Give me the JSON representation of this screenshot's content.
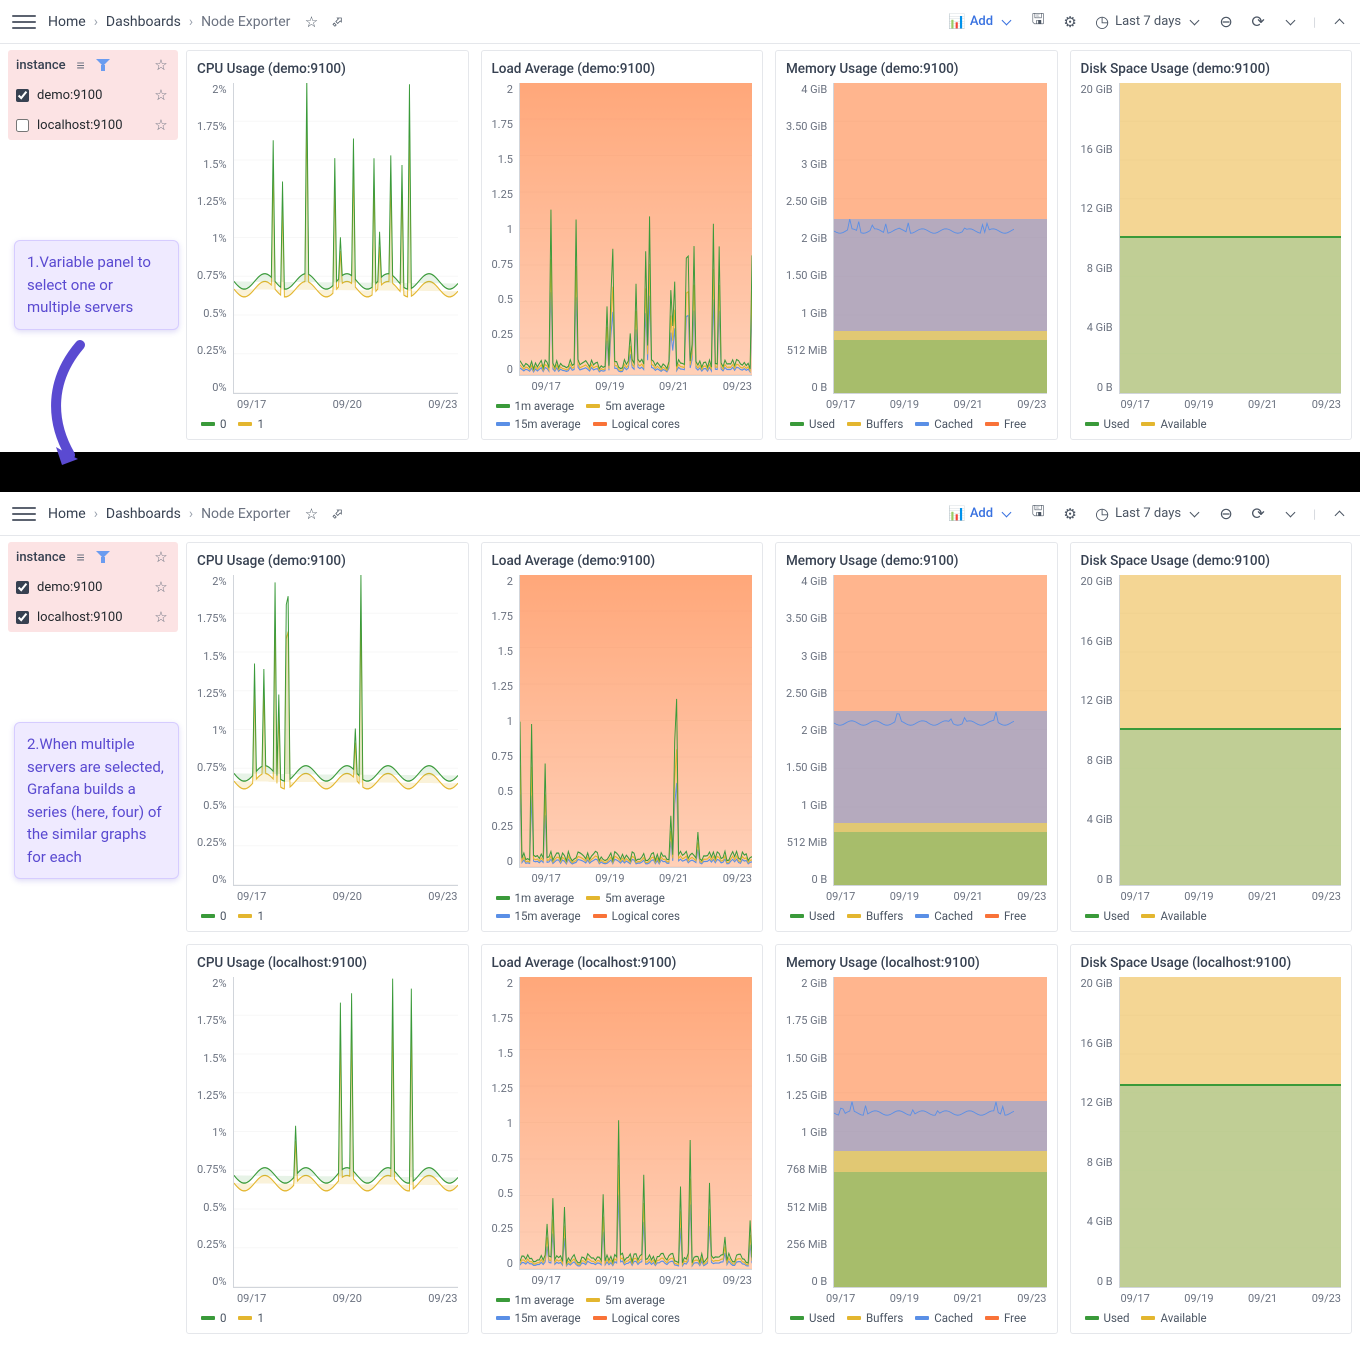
{
  "toolbar": {
    "breadcrumb": {
      "home": "Home",
      "dashboards": "Dashboards",
      "current": "Node Exporter"
    },
    "add": "Add",
    "timerange": "Last 7 days"
  },
  "annotations": {
    "a1": "1.Variable panel to select one or multiple servers",
    "a2": "2.When  multiple servers are selected, Grafana builds a series (here, four) of the similar graphs for each"
  },
  "sections": [
    {
      "varpanel": {
        "title": "instance",
        "items": [
          {
            "label": "demo:9100",
            "checked": true
          },
          {
            "label": "localhost:9100",
            "checked": false
          }
        ]
      },
      "panels_for": [
        "demo:9100"
      ]
    },
    {
      "varpanel": {
        "title": "instance",
        "items": [
          {
            "label": "demo:9100",
            "checked": true
          },
          {
            "label": "localhost:9100",
            "checked": true
          }
        ]
      },
      "panels_for": [
        "demo:9100",
        "localhost:9100"
      ]
    }
  ],
  "panel_templates": {
    "cpu": {
      "title_prefix": "CPU Usage",
      "yticks": [
        "2%",
        "1.75%",
        "1.5%",
        "1.25%",
        "1%",
        "0.75%",
        "0.5%",
        "0.25%",
        "0%"
      ],
      "xticks": [
        "09/17",
        "09/20",
        "09/23"
      ],
      "legend": [
        {
          "label": "0",
          "color": "#3a9a3a"
        },
        {
          "label": "1",
          "color": "#e3b62f"
        }
      ]
    },
    "load": {
      "title_prefix": "Load Average",
      "yticks": [
        "2",
        "1.75",
        "1.5",
        "1.25",
        "1",
        "0.75",
        "0.5",
        "0.25",
        "0"
      ],
      "xticks": [
        "09/17",
        "09/19",
        "09/21",
        "09/23"
      ],
      "legend": [
        {
          "label": "1m average",
          "color": "#3a9a3a"
        },
        {
          "label": "5m average",
          "color": "#e3b62f"
        },
        {
          "label": "15m average",
          "color": "#5a8fe6"
        },
        {
          "label": "Logical cores",
          "color": "#f97238"
        }
      ]
    },
    "mem": {
      "title_prefix": "Memory Usage",
      "yticks_demo": [
        "4 GiB",
        "3.50 GiB",
        "3 GiB",
        "2.50 GiB",
        "2 GiB",
        "1.50 GiB",
        "1 GiB",
        "512 MiB",
        "0 B"
      ],
      "yticks_localhost": [
        "2 GiB",
        "1.75 GiB",
        "1.50 GiB",
        "1.25 GiB",
        "1 GiB",
        "768 MiB",
        "512 MiB",
        "256 MiB",
        "0 B"
      ],
      "xticks": [
        "09/17",
        "09/19",
        "09/21",
        "09/23"
      ],
      "legend": [
        {
          "label": "Used",
          "color": "#3a9a3a"
        },
        {
          "label": "Buffers",
          "color": "#e3b62f"
        },
        {
          "label": "Cached",
          "color": "#5a8fe6"
        },
        {
          "label": "Free",
          "color": "#f97238"
        }
      ]
    },
    "disk": {
      "title_prefix": "Disk Space Usage",
      "yticks": [
        "20 GiB",
        "16 GiB",
        "12 GiB",
        "8 GiB",
        "4 GiB",
        "0 B"
      ],
      "xticks": [
        "09/17",
        "09/19",
        "09/21",
        "09/23"
      ],
      "legend": [
        {
          "label": "Used",
          "color": "#3a9a3a"
        },
        {
          "label": "Available",
          "color": "#e3b62f"
        }
      ]
    }
  },
  "chart_data": [
    {
      "type": "line",
      "title": "CPU Usage (demo:9100)",
      "xlabel": "",
      "ylabel": "%",
      "ylim": [
        0,
        2
      ],
      "x": [
        "09/17",
        "09/18",
        "09/19",
        "09/20",
        "09/21",
        "09/22",
        "09/23"
      ],
      "series": [
        {
          "name": "0",
          "color": "#3a9a3a",
          "values": [
            0.6,
            0.95,
            0.8,
            1.2,
            0.9,
            0.85,
            0.8
          ]
        },
        {
          "name": "1",
          "color": "#e3b62f",
          "values": [
            0.55,
            0.9,
            0.75,
            1.1,
            0.85,
            0.8,
            0.75
          ]
        }
      ]
    },
    {
      "type": "line",
      "title": "Load Average (demo:9100)",
      "ylim": [
        0,
        2
      ],
      "x": [
        "09/17",
        "09/18",
        "09/19",
        "09/20",
        "09/21",
        "09/22",
        "09/23"
      ],
      "series": [
        {
          "name": "1m average",
          "color": "#3a9a3a",
          "values": [
            0.4,
            0.1,
            0.05,
            0.45,
            0.05,
            0.1,
            0.3
          ]
        },
        {
          "name": "5m average",
          "color": "#e3b62f",
          "values": [
            0.3,
            0.08,
            0.04,
            0.35,
            0.04,
            0.08,
            0.25
          ]
        },
        {
          "name": "15m average",
          "color": "#5a8fe6",
          "values": [
            0.2,
            0.05,
            0.03,
            0.25,
            0.03,
            0.05,
            0.2
          ]
        },
        {
          "name": "Logical cores",
          "color": "#f97238",
          "values": [
            2,
            2,
            2,
            2,
            2,
            2,
            2
          ]
        }
      ]
    },
    {
      "type": "area",
      "title": "Memory Usage (demo:9100)",
      "ylim": [
        0,
        4
      ],
      "yunit": "GiB",
      "x": [
        "09/17",
        "09/18",
        "09/19",
        "09/20",
        "09/21",
        "09/22",
        "09/23"
      ],
      "series": [
        {
          "name": "Used",
          "color": "#3a9a3a",
          "values": [
            0.65,
            0.7,
            0.68,
            0.72,
            0.7,
            0.68,
            0.7
          ]
        },
        {
          "name": "Buffers",
          "color": "#e3b62f",
          "values": [
            0.15,
            0.15,
            0.15,
            0.15,
            0.15,
            0.15,
            0.15
          ]
        },
        {
          "name": "Cached",
          "color": "#5a8fe6",
          "values": [
            1.2,
            1.3,
            1.4,
            1.35,
            1.45,
            1.4,
            1.45
          ]
        },
        {
          "name": "Free",
          "color": "#f97238",
          "values": [
            2.0,
            1.85,
            1.77,
            1.78,
            1.7,
            1.77,
            1.7
          ]
        }
      ]
    },
    {
      "type": "area",
      "title": "Disk Space Usage (demo:9100)",
      "ylim": [
        0,
        20
      ],
      "yunit": "GiB",
      "x": [
        "09/17",
        "09/18",
        "09/19",
        "09/20",
        "09/21",
        "09/22",
        "09/23"
      ],
      "series": [
        {
          "name": "Used",
          "color": "#3a9a3a",
          "values": [
            10,
            10,
            10,
            10,
            10,
            10,
            10
          ]
        },
        {
          "name": "Available",
          "color": "#e3b62f",
          "values": [
            10,
            10,
            10,
            10,
            10,
            10,
            10
          ]
        }
      ]
    },
    {
      "type": "line",
      "title": "CPU Usage (localhost:9100)",
      "ylim": [
        0,
        2
      ],
      "ylabel": "%",
      "x": [
        "09/17",
        "09/18",
        "09/19",
        "09/20",
        "09/21",
        "09/22",
        "09/23"
      ],
      "series": [
        {
          "name": "0",
          "color": "#3a9a3a",
          "values": [
            0.35,
            0.8,
            0.4,
            0.55,
            0.4,
            0.45,
            0.4
          ]
        },
        {
          "name": "1",
          "color": "#e3b62f",
          "values": [
            0.33,
            0.75,
            0.38,
            0.52,
            0.38,
            0.42,
            0.38
          ]
        }
      ]
    },
    {
      "type": "line",
      "title": "Load Average (localhost:9100)",
      "ylim": [
        0,
        2
      ],
      "x": [
        "09/17",
        "09/18",
        "09/19",
        "09/20",
        "09/21",
        "09/22",
        "09/23"
      ],
      "series": [
        {
          "name": "1m average",
          "color": "#3a9a3a",
          "values": [
            0.3,
            0.05,
            0.03,
            0.2,
            0.05,
            0.05,
            0.35
          ]
        },
        {
          "name": "5m average",
          "color": "#e3b62f",
          "values": [
            0.22,
            0.04,
            0.02,
            0.15,
            0.04,
            0.04,
            0.28
          ]
        },
        {
          "name": "15m average",
          "color": "#5a8fe6",
          "values": [
            0.15,
            0.03,
            0.02,
            0.1,
            0.03,
            0.03,
            0.2
          ]
        },
        {
          "name": "Logical cores",
          "color": "#f97238",
          "values": [
            2,
            2,
            2,
            2,
            2,
            2,
            2
          ]
        }
      ]
    },
    {
      "type": "area",
      "title": "Memory Usage (localhost:9100)",
      "ylim": [
        0,
        2
      ],
      "yunit": "GiB",
      "x": [
        "09/17",
        "09/18",
        "09/19",
        "09/20",
        "09/21",
        "09/22",
        "09/23"
      ],
      "series": [
        {
          "name": "Used",
          "color": "#3a9a3a",
          "values": [
            0.7,
            0.72,
            0.7,
            0.73,
            0.72,
            0.71,
            0.72
          ]
        },
        {
          "name": "Buffers",
          "color": "#e3b62f",
          "values": [
            0.12,
            0.12,
            0.12,
            0.12,
            0.12,
            0.12,
            0.12
          ]
        },
        {
          "name": "Cached",
          "color": "#5a8fe6",
          "values": [
            0.35,
            0.38,
            0.4,
            0.38,
            0.42,
            0.4,
            0.4
          ]
        },
        {
          "name": "Free",
          "color": "#f97238",
          "values": [
            0.83,
            0.78,
            0.78,
            0.77,
            0.74,
            0.77,
            0.76
          ]
        }
      ]
    },
    {
      "type": "area",
      "title": "Disk Space Usage (localhost:9100)",
      "ylim": [
        0,
        20
      ],
      "yunit": "GiB",
      "x": [
        "09/17",
        "09/18",
        "09/19",
        "09/20",
        "09/21",
        "09/22",
        "09/23"
      ],
      "series": [
        {
          "name": "Used",
          "color": "#3a9a3a",
          "values": [
            13,
            13,
            13,
            13,
            13,
            13,
            13
          ]
        },
        {
          "name": "Available",
          "color": "#e3b62f",
          "values": [
            7,
            7,
            7,
            7,
            7,
            7,
            7
          ]
        }
      ]
    }
  ]
}
